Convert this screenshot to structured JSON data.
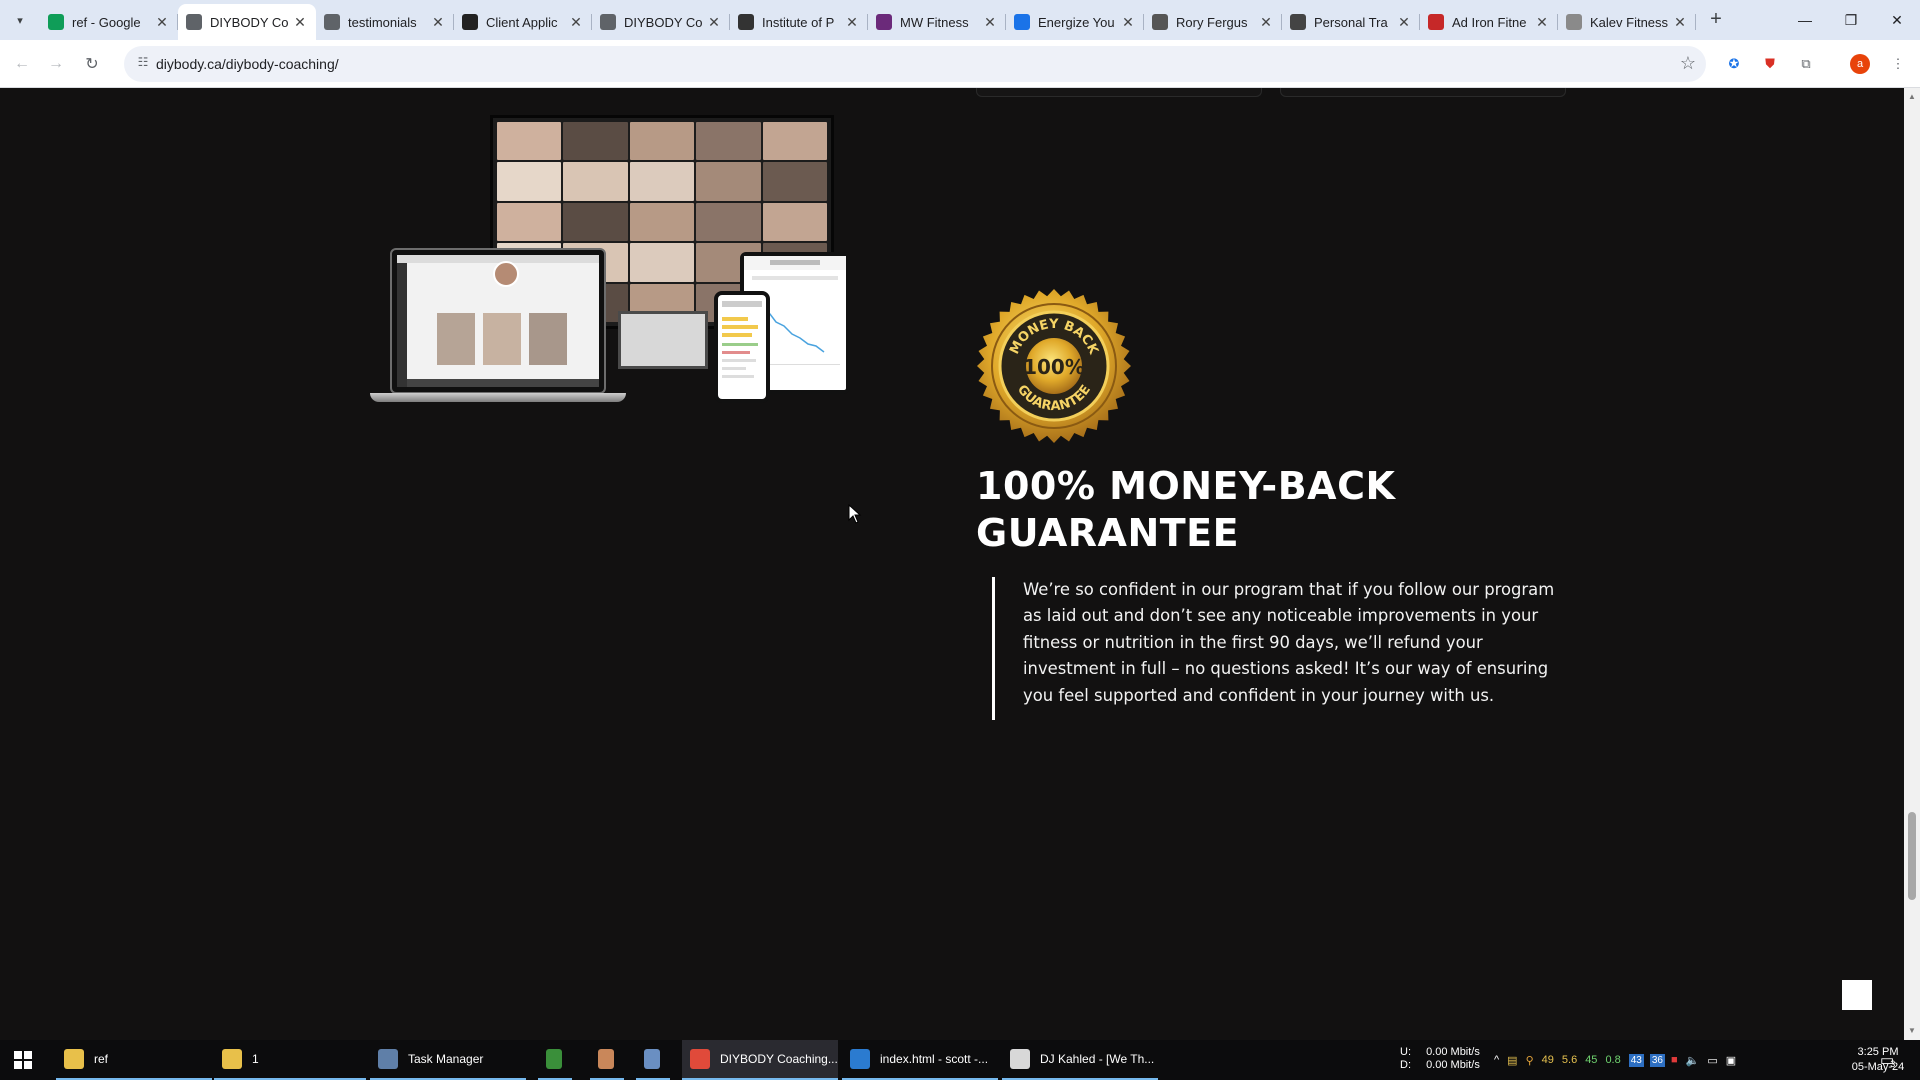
{
  "browser": {
    "tabs": [
      {
        "title": "ref - Google",
        "favicon": "sheets-icon",
        "color": "#0f9d58",
        "active": false
      },
      {
        "title": "DIYBODY Co",
        "favicon": "globe-icon",
        "color": "#5f6368",
        "active": true
      },
      {
        "title": "testimonials",
        "favicon": "globe-icon",
        "color": "#5f6368",
        "active": false
      },
      {
        "title": "Client Applic",
        "favicon": "form-icon",
        "color": "#222222",
        "active": false
      },
      {
        "title": "DIYBODY Co",
        "favicon": "globe-icon",
        "color": "#5f6368",
        "active": false
      },
      {
        "title": "Institute of P",
        "favicon": "shield-icon",
        "color": "#333333",
        "active": false
      },
      {
        "title": "MW Fitness",
        "favicon": "mw-icon",
        "color": "#6b2a7a",
        "active": false
      },
      {
        "title": "Energize You",
        "favicon": "chevron-up-icon",
        "color": "#1a73e8",
        "active": false
      },
      {
        "title": "Rory Fergus",
        "favicon": "arc-icon",
        "color": "#555555",
        "active": false
      },
      {
        "title": "Personal Tra",
        "favicon": "wrench-icon",
        "color": "#444444",
        "active": false
      },
      {
        "title": "Ad Iron Fitne",
        "favicon": "target-icon",
        "color": "#c62828",
        "active": false
      },
      {
        "title": "Kalev Fitness",
        "favicon": "page-icon",
        "color": "#8a8a8a",
        "active": false
      }
    ],
    "url": "diybody.ca/diybody-coaching/",
    "profile_initial": "a"
  },
  "page": {
    "badge": {
      "top_text": "MONEY BACK",
      "center_text": "100%",
      "bottom_text": "GUARANTEE"
    },
    "headline_line1": "100% MONEY-BACK",
    "headline_line2": "GUARANTEE",
    "body": "We’re so confident in our program that if you follow our program as laid out and don’t see any noticeable improvements in your fitness or nutrition in the first 90 days, we’ll refund your investment in full – no questions asked! It’s our way of ensuring you feel supported and confident in your journey with us."
  },
  "taskbar": {
    "items": [
      {
        "label": "ref",
        "icon": "folder-icon"
      },
      {
        "label": "1",
        "icon": "folder-icon"
      },
      {
        "label": "Task Manager",
        "icon": "task-manager-icon"
      },
      {
        "label": "",
        "icon": "spreadsheet-app-icon"
      },
      {
        "label": "",
        "icon": "app-icon"
      },
      {
        "label": "",
        "icon": "notepad-icon"
      },
      {
        "label": "DIYBODY Coaching...",
        "icon": "chrome-icon"
      },
      {
        "label": "index.html - scott -...",
        "icon": "vscode-icon"
      },
      {
        "label": "DJ Kahled - [We Th...",
        "icon": "winamp-icon"
      }
    ],
    "net_up_label": "U:",
    "net_down_label": "D:",
    "net_up": "0.00 Mbit/s",
    "net_down": "0.00 Mbit/s",
    "tray_numbers": [
      "49",
      "5.6",
      "45",
      "0.8"
    ],
    "tray_badges": [
      "43",
      "36"
    ],
    "time": "3:25 PM",
    "date": "05-May-24",
    "notification_count": "3"
  }
}
